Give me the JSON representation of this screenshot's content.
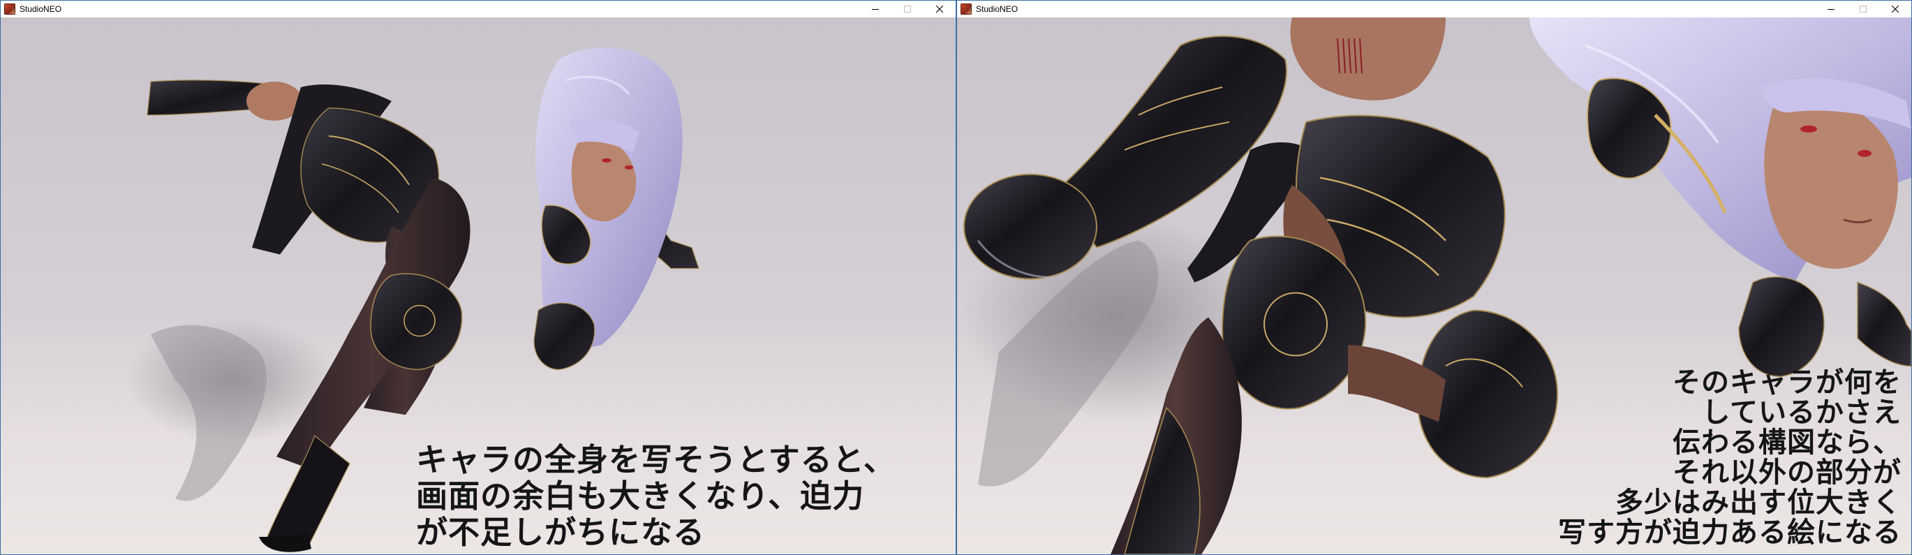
{
  "windows": [
    {
      "title": "StudioNEO",
      "app_icon": "studioneo-app-icon",
      "controls": {
        "minimize": "minimize-icon",
        "maximize": "maximize-icon",
        "close": "close-icon"
      },
      "caption": "キャラの全身を写そうとすると、\n画面の余白も大きくなり、迫力\nが不足しがちになる"
    },
    {
      "title": "StudioNEO",
      "app_icon": "studioneo-app-icon",
      "controls": {
        "minimize": "minimize-icon",
        "maximize": "maximize-icon",
        "close": "close-icon"
      },
      "caption": "そのキャラが何を\nしているかさえ\n伝わる構図なら、\nそれ以外の部分が\n多少はみ出す位大きく\n写す方が迫力ある絵になる"
    }
  ],
  "colors": {
    "titlebar": "#ffffff",
    "window_border": "#3b6ea5",
    "background_top": "#c9c4cb",
    "background_bottom": "#ece6e5",
    "hair": "#b9b3dc",
    "armor": "#1e1c22",
    "armor_trim": "#a88a52",
    "skin": "#b07a62",
    "caption_text": "#151515"
  }
}
